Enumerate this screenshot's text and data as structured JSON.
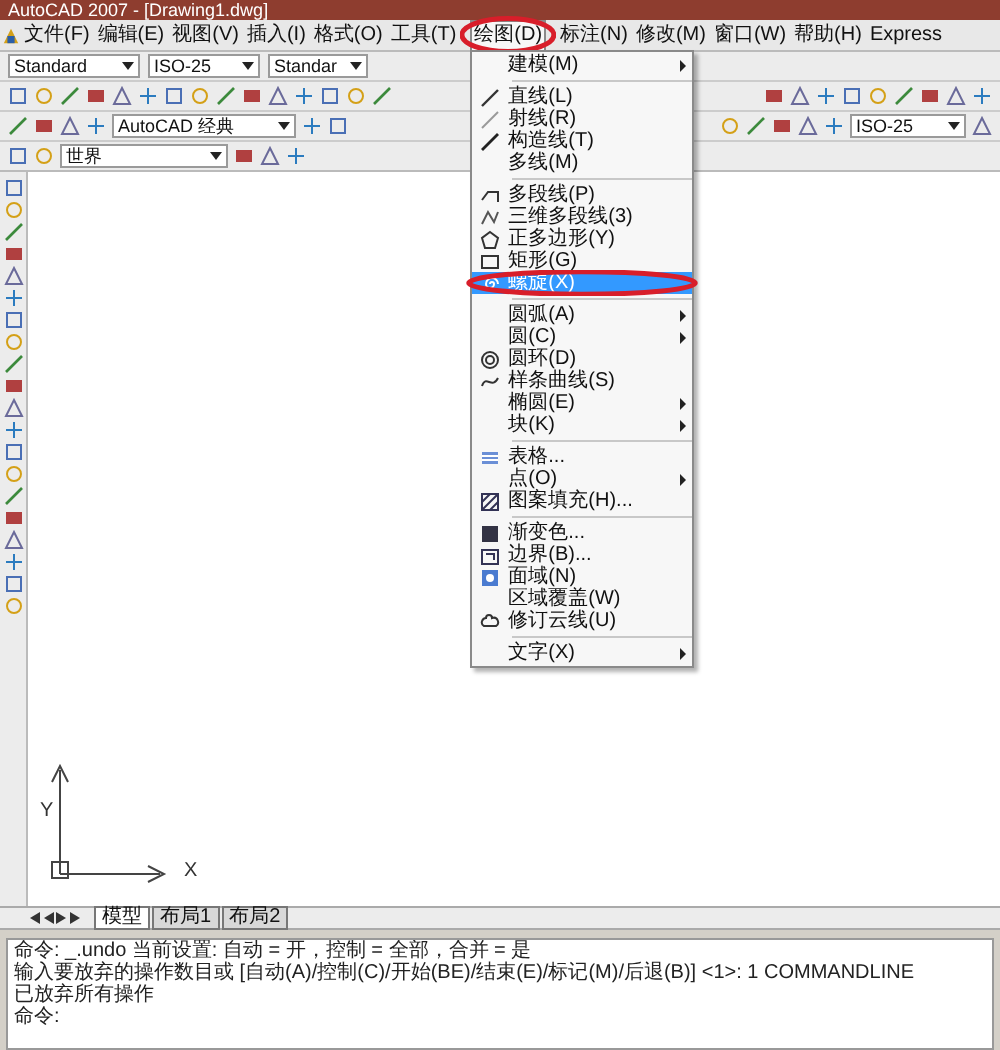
{
  "window": {
    "title": "AutoCAD 2007 - [Drawing1.dwg]"
  },
  "menubar": [
    {
      "label": "文件(F)",
      "selected": false,
      "circled": false
    },
    {
      "label": "编辑(E)",
      "selected": false,
      "circled": false
    },
    {
      "label": "视图(V)",
      "selected": false,
      "circled": false
    },
    {
      "label": "插入(I)",
      "selected": false,
      "circled": false
    },
    {
      "label": "格式(O)",
      "selected": false,
      "circled": false
    },
    {
      "label": "工具(T)",
      "selected": false,
      "circled": false
    },
    {
      "label": "绘图(D)",
      "selected": true,
      "circled": true
    },
    {
      "label": "标注(N)",
      "selected": false,
      "circled": false
    },
    {
      "label": "修改(M)",
      "selected": false,
      "circled": false
    },
    {
      "label": "窗口(W)",
      "selected": false,
      "circled": false
    },
    {
      "label": "帮助(H)",
      "selected": false,
      "circled": false
    },
    {
      "label": "Express",
      "selected": false,
      "circled": false
    }
  ],
  "toolbars": {
    "text_style": "Standard",
    "dim_style": "ISO-25",
    "table_style": "Standar",
    "workspace": "AutoCAD 经典",
    "dim_style_2": "ISO-25",
    "ucs": "世界"
  },
  "dropdown": [
    {
      "kind": "item",
      "label": "建模(M)",
      "submenu": true,
      "selected": false,
      "circled": false
    },
    {
      "kind": "separator"
    },
    {
      "kind": "item",
      "label": "直线(L)",
      "submenu": false,
      "selected": false,
      "circled": false
    },
    {
      "kind": "item",
      "label": "射线(R)",
      "submenu": false,
      "selected": false,
      "circled": false
    },
    {
      "kind": "item",
      "label": "构造线(T)",
      "submenu": false,
      "selected": false,
      "circled": false
    },
    {
      "kind": "item",
      "label": "多线(M)",
      "submenu": false,
      "selected": false,
      "circled": false
    },
    {
      "kind": "separator"
    },
    {
      "kind": "item",
      "label": "多段线(P)",
      "submenu": false,
      "selected": false,
      "circled": false
    },
    {
      "kind": "item",
      "label": "三维多段线(3)",
      "submenu": false,
      "selected": false,
      "circled": false
    },
    {
      "kind": "item",
      "label": "正多边形(Y)",
      "submenu": false,
      "selected": false,
      "circled": false
    },
    {
      "kind": "item",
      "label": "矩形(G)",
      "submenu": false,
      "selected": false,
      "circled": false
    },
    {
      "kind": "item",
      "label": "螺旋(X)",
      "submenu": false,
      "selected": true,
      "circled": true
    },
    {
      "kind": "separator"
    },
    {
      "kind": "item",
      "label": "圆弧(A)",
      "submenu": true,
      "selected": false,
      "circled": false
    },
    {
      "kind": "item",
      "label": "圆(C)",
      "submenu": true,
      "selected": false,
      "circled": false
    },
    {
      "kind": "item",
      "label": "圆环(D)",
      "submenu": false,
      "selected": false,
      "circled": false
    },
    {
      "kind": "item",
      "label": "样条曲线(S)",
      "submenu": false,
      "selected": false,
      "circled": false
    },
    {
      "kind": "item",
      "label": "椭圆(E)",
      "submenu": true,
      "selected": false,
      "circled": false
    },
    {
      "kind": "item",
      "label": "块(K)",
      "submenu": true,
      "selected": false,
      "circled": false
    },
    {
      "kind": "separator"
    },
    {
      "kind": "item",
      "label": "表格...",
      "submenu": false,
      "selected": false,
      "circled": false
    },
    {
      "kind": "item",
      "label": "点(O)",
      "submenu": true,
      "selected": false,
      "circled": false
    },
    {
      "kind": "item",
      "label": "图案填充(H)...",
      "submenu": false,
      "selected": false,
      "circled": false
    },
    {
      "kind": "separator"
    },
    {
      "kind": "item",
      "label": "渐变色...",
      "submenu": false,
      "selected": false,
      "circled": false
    },
    {
      "kind": "item",
      "label": "边界(B)...",
      "submenu": false,
      "selected": false,
      "circled": false
    },
    {
      "kind": "item",
      "label": "面域(N)",
      "submenu": false,
      "selected": false,
      "circled": false
    },
    {
      "kind": "item",
      "label": "区域覆盖(W)",
      "submenu": false,
      "selected": false,
      "circled": false
    },
    {
      "kind": "item",
      "label": "修订云线(U)",
      "submenu": false,
      "selected": false,
      "circled": false
    },
    {
      "kind": "separator"
    },
    {
      "kind": "item",
      "label": "文字(X)",
      "submenu": true,
      "selected": false,
      "circled": false
    }
  ],
  "ucs_axes": {
    "x": "X",
    "y": "Y"
  },
  "layout_tabs": [
    {
      "label": "模型",
      "selected": true
    },
    {
      "label": "布局1",
      "selected": false
    },
    {
      "label": "布局2",
      "selected": false
    }
  ],
  "command_lines": [
    "命令: _.undo 当前设置: 自动 = 开，控制 = 全部，合并 = 是",
    "输入要放弃的操作数目或 [自动(A)/控制(C)/开始(BE)/结束(E)/标记(M)/后退(B)] <1>: 1 COMMANDLINE",
    "已放弃所有操作",
    "命令:"
  ]
}
